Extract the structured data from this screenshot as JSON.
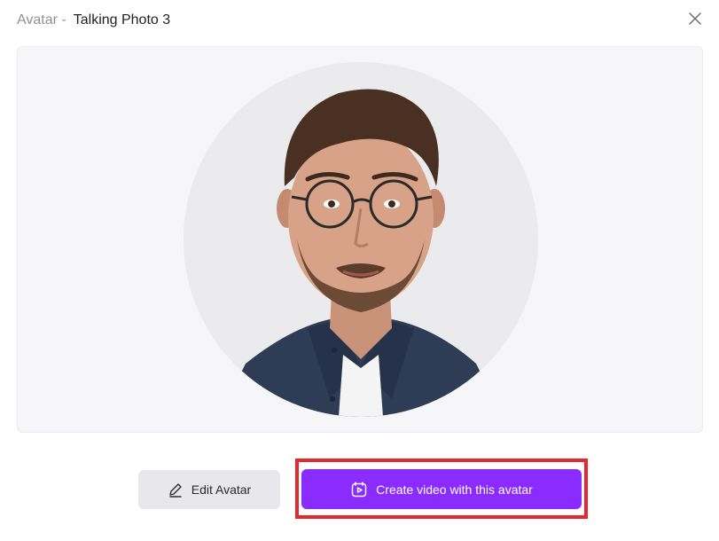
{
  "header": {
    "prefix": "Avatar -",
    "title": "Talking Photo 3"
  },
  "icons": {
    "close": "close-icon",
    "edit": "pencil-icon",
    "video": "video-avatar-icon"
  },
  "preview": {
    "image": "avatar-portrait"
  },
  "actions": {
    "edit_label": "Edit Avatar",
    "create_label": "Create video with this avatar"
  },
  "colors": {
    "accent": "#8a2cff",
    "highlight": "#e8262d",
    "secondary_button": "#e8e8ec"
  }
}
